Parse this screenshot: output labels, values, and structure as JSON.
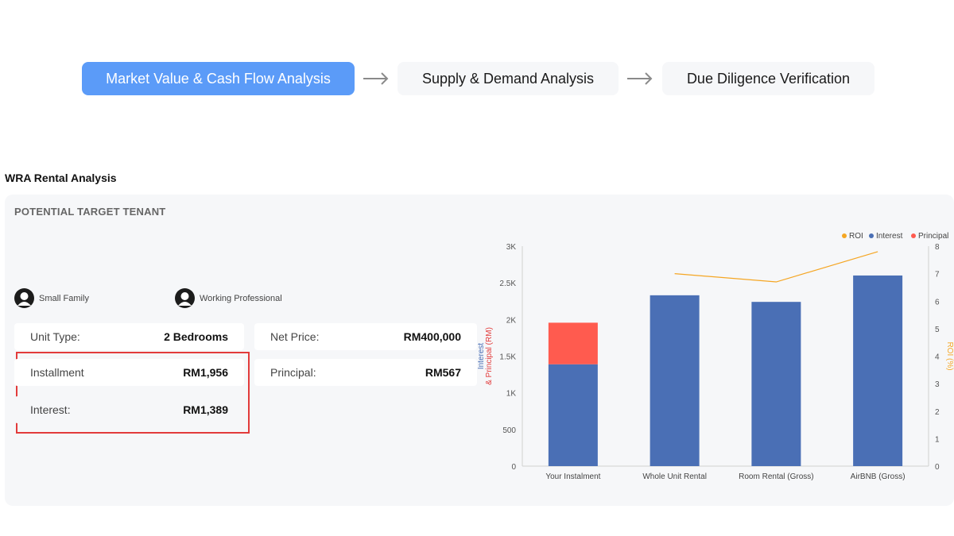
{
  "stepper": {
    "steps": [
      {
        "label": "Market Value & Cash Flow Analysis",
        "active": true
      },
      {
        "label": "Supply & Demand Analysis",
        "active": false
      },
      {
        "label": "Due Diligence Verification",
        "active": false
      }
    ]
  },
  "section_title": "WRA Rental Analysis",
  "panel": {
    "title": "POTENTIAL TARGET TENANT",
    "tenants": [
      "Small Family",
      "Working Professional"
    ],
    "rows": {
      "unit_type": {
        "label": "Unit Type:",
        "value": "2 Bedrooms"
      },
      "installment": {
        "label": "Installment",
        "value": "RM1,956"
      },
      "interest": {
        "label": "Interest:",
        "value": "RM1,389"
      },
      "net_price": {
        "label": "Net Price:",
        "value": "RM400,000"
      },
      "principal": {
        "label": "Principal:",
        "value": "RM567"
      }
    }
  },
  "colors": {
    "accent": "#5b9bf8",
    "interest": "#4a6fb5",
    "principal": "#ff5b4f",
    "roi": "#f5a623",
    "highlight": "#e23b3b"
  },
  "chart_data": {
    "type": "bar",
    "categories": [
      "Your Instalment",
      "Whole Unit Rental",
      "Room Rental (Gross)",
      "AirBNB (Gross)"
    ],
    "series": [
      {
        "name": "Interest",
        "values": [
          1389,
          2330,
          2240,
          2600
        ]
      },
      {
        "name": "Principal",
        "values": [
          567,
          0,
          0,
          0
        ]
      },
      {
        "name": "ROI",
        "axis": "right",
        "values": [
          null,
          7.0,
          6.7,
          7.8
        ]
      }
    ],
    "legend": [
      "ROI",
      "Interest",
      "Principal"
    ],
    "ylabel": "Interest & Principal (RM)",
    "y2label": "ROI (%)",
    "ylim": [
      0,
      3000
    ],
    "y2lim": [
      0,
      8
    ],
    "yticks": [
      "0",
      "500",
      "1K",
      "1.5K",
      "2K",
      "2.5K",
      "3K"
    ],
    "y2ticks": [
      "0",
      "1",
      "2",
      "3",
      "4",
      "5",
      "6",
      "7",
      "8"
    ],
    "legend_position": "top-right",
    "grid": false
  }
}
